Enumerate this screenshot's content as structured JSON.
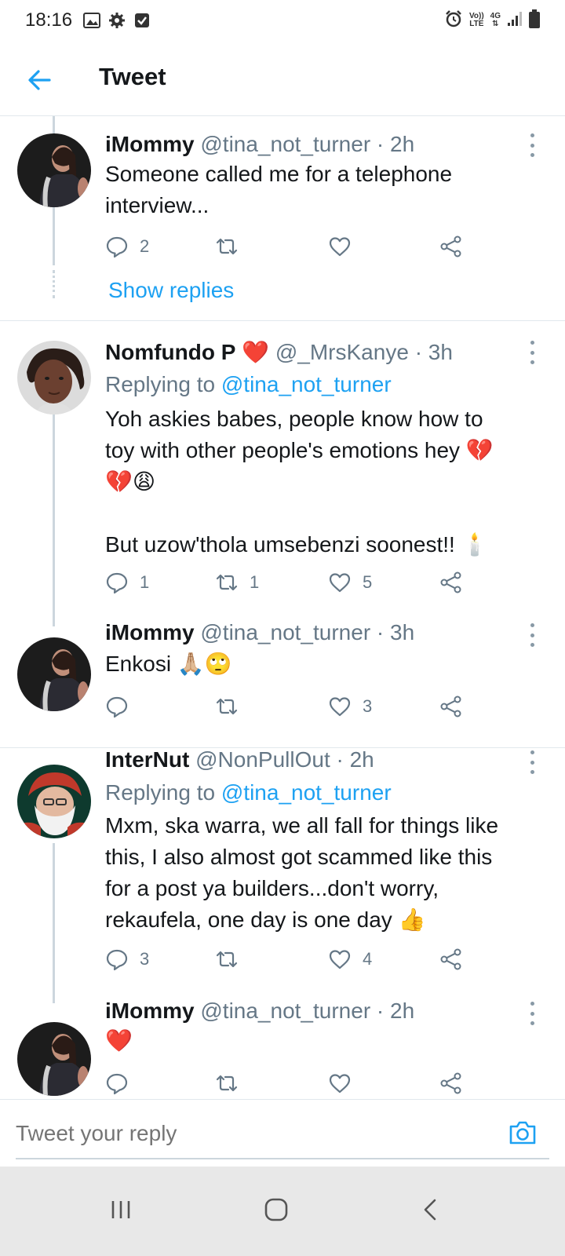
{
  "status_bar": {
    "time": "18:16",
    "left_icons": [
      "image-icon",
      "settings-icon",
      "checkbox-icon"
    ],
    "right_icons": [
      "alarm-icon",
      "volte-icon",
      "4g-icon",
      "signal-icon",
      "battery-icon"
    ],
    "volte_label_top": "Vo))",
    "volte_label_bottom": "LTE",
    "network_label": "4G"
  },
  "header": {
    "back_icon": "arrow-left-icon",
    "title": "Tweet"
  },
  "colors": {
    "accent": "#1da1f2",
    "text": "#14171a",
    "muted": "#657786",
    "divider": "#e1e8ed"
  },
  "tweets": [
    {
      "name": "iMommy",
      "handle": "@tina_not_turner",
      "time": "· 2h",
      "text": "Someone called me for a telephone\ninterview...",
      "reply_count": "2",
      "retweet_count": "",
      "like_count": "",
      "show_replies": "Show replies"
    },
    {
      "name": "Nomfundo P",
      "name_emoji": "❤️",
      "handle": "@_MrsKanye",
      "time": "· 3h",
      "replying_label": "Replying to",
      "replying_to": "@tina_not_turner",
      "text": "Yoh askies babes, people know how to\ntoy with other people's emotions hey 💔\n💔😩\n\nBut uzow'thola umsebenzi soonest!! 🕯️",
      "reply_count": "1",
      "retweet_count": "1",
      "like_count": "5"
    },
    {
      "name": "iMommy",
      "handle": "@tina_not_turner",
      "time": "· 3h",
      "text": "Enkosi 🙏🏼🙄",
      "reply_count": "",
      "retweet_count": "",
      "like_count": "3"
    },
    {
      "name": "InterNut",
      "handle": "@NonPullOut",
      "time": "· 2h",
      "replying_label": "Replying to",
      "replying_to": "@tina_not_turner",
      "text": "Mxm, ska warra, we all fall for things like\nthis, I also almost got scammed like this\nfor a post ya builders...don't worry,\nrekaufela, one day is one day 👍",
      "reply_count": "3",
      "retweet_count": "",
      "like_count": "4"
    },
    {
      "name": "iMommy",
      "handle": "@tina_not_turner",
      "time": "· 2h",
      "text": "❤️",
      "reply_count": "",
      "retweet_count": "",
      "like_count": ""
    }
  ],
  "reply_bar": {
    "placeholder": "Tweet your reply",
    "camera_icon": "camera-icon"
  },
  "nav_bar": {
    "icons": [
      "recent-apps-icon",
      "home-icon",
      "back-icon"
    ]
  }
}
